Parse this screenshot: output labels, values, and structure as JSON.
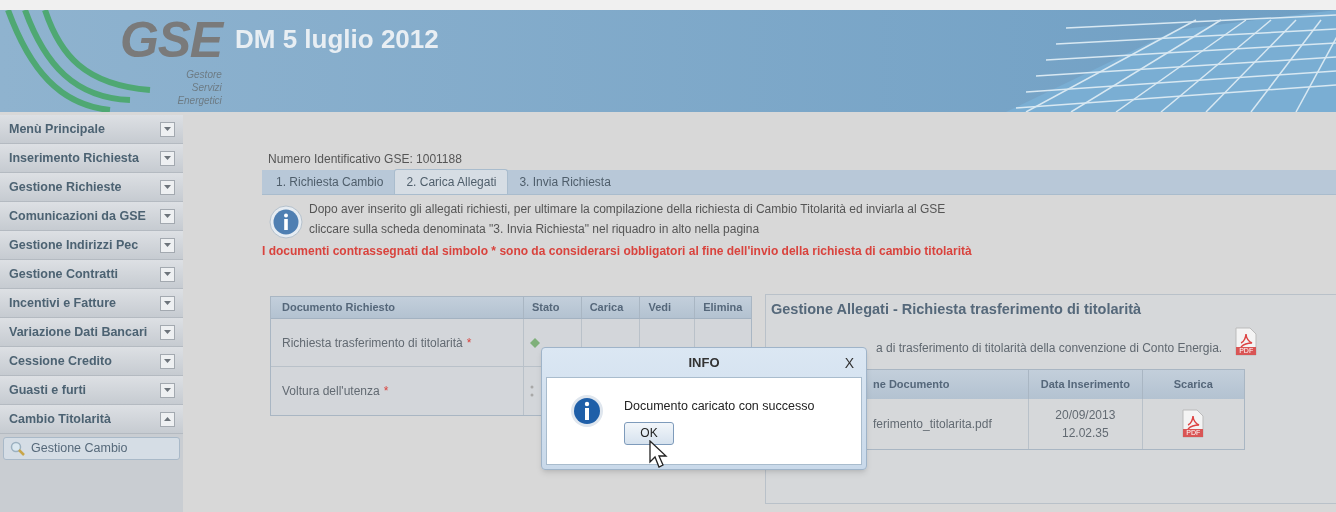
{
  "header": {
    "logo_text": "GSE",
    "logo_subtitle": [
      "Gestore",
      "Servizi",
      "Energetici"
    ],
    "title": "DM 5 luglio 2012"
  },
  "sidebar": {
    "items": [
      {
        "label": "Menù Principale",
        "expanded": false
      },
      {
        "label": "Inserimento Richiesta",
        "expanded": false
      },
      {
        "label": "Gestione Richieste",
        "expanded": false
      },
      {
        "label": "Comunicazioni da GSE",
        "expanded": false
      },
      {
        "label": "Gestione Indirizzi Pec",
        "expanded": false
      },
      {
        "label": "Gestione Contratti",
        "expanded": false
      },
      {
        "label": "Incentivi e Fatture",
        "expanded": false
      },
      {
        "label": "Variazione Dati Bancari",
        "expanded": false
      },
      {
        "label": "Cessione Credito",
        "expanded": false
      },
      {
        "label": "Guasti e furti",
        "expanded": false
      },
      {
        "label": "Cambio Titolarità",
        "expanded": true,
        "children": [
          {
            "label": "Gestione Cambio"
          }
        ]
      }
    ]
  },
  "main": {
    "id_label": "Numero Identificativo GSE: 1001188",
    "tabs": [
      {
        "label": "1. Richiesta Cambio",
        "selected": false
      },
      {
        "label": "2. Carica Allegati",
        "selected": true
      },
      {
        "label": "3. Invia Richiesta",
        "selected": false
      }
    ],
    "info_lines": [
      "Dopo aver inserito gli allegati richiesti, per ultimare la compilazione della richiesta di Cambio Titolarità ed inviarla al GSE",
      "cliccare sulla scheda denominata \"3. Invia Richiesta\" nel riquadro in alto nella pagina"
    ],
    "warning": "I documenti contrassegnati dal simbolo * sono da considerarsi obbligatori al fine dell'invio della richiesta di cambio titolarità",
    "documents_table": {
      "columns": [
        "Documento Richiesto",
        "Stato",
        "Carica",
        "Vedi",
        "Elimina"
      ],
      "rows": [
        {
          "document": "Richiesta trasferimento di titolarità",
          "required_mark": "*",
          "uploaded": true
        },
        {
          "document": "Voltura dell'utenza",
          "required_mark": "*",
          "uploaded": false
        }
      ]
    },
    "attachments": {
      "pdf_label": "PDF",
      "title": "Gestione Allegati - Richiesta trasferimento di titolarità",
      "description": "a di trasferimento di titolarità della convenzione di Conto Energia.",
      "table": {
        "columns": [
          "ne Documento",
          "Data Inserimento",
          "Scarica"
        ],
        "rows": [
          {
            "name": "ferimento_titolarita.pdf",
            "date": "20/09/2013",
            "time": "12.02.35",
            "download_label": "PDF"
          }
        ]
      }
    }
  },
  "dialog": {
    "title": "INFO",
    "close": "X",
    "message": "Documento caricato con successo",
    "button": "OK"
  }
}
